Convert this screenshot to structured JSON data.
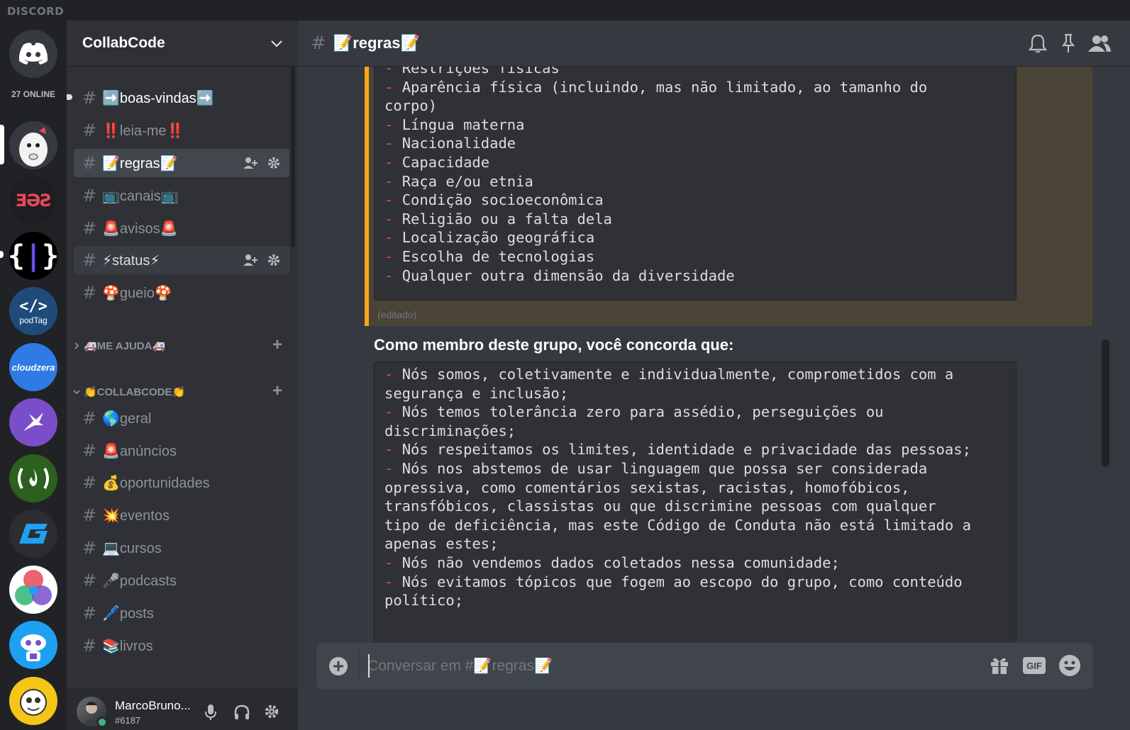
{
  "app": {
    "brand": "DISCORD"
  },
  "rail": {
    "online_count": "27 ONLINE",
    "servers": [
      {
        "id": "home",
        "color": "#36393f",
        "label": ""
      },
      {
        "id": "collabcode",
        "color": "#36393f",
        "label": ""
      },
      {
        "id": "server-3",
        "color": "#1e1e22",
        "label": ""
      },
      {
        "id": "server-4",
        "color": "#000000",
        "label": ""
      },
      {
        "id": "podtag",
        "color": "#1f4b7a",
        "label": "podTag"
      },
      {
        "id": "cloudzera",
        "color": "#2f7ae5",
        "label": "cloudzera"
      },
      {
        "id": "server-7",
        "color": "#7b4ec9",
        "label": ""
      },
      {
        "id": "freecodecamp",
        "color": "#2d5f1e",
        "label": ""
      },
      {
        "id": "server-9",
        "color": "#2b2d31",
        "label": ""
      },
      {
        "id": "server-10",
        "color": "#ffffff",
        "label": ""
      },
      {
        "id": "server-11",
        "color": "#1ea1f2",
        "label": ""
      },
      {
        "id": "server-12",
        "color": "#f5c518",
        "label": ""
      }
    ]
  },
  "guild": {
    "name": "CollabCode"
  },
  "channels": [
    {
      "label": "➡️boas-vindas➡️",
      "state": "unread"
    },
    {
      "label": "‼️leia-me‼️",
      "state": "normal"
    },
    {
      "label": "📝regras📝",
      "state": "active"
    },
    {
      "label": "📺canais📺",
      "state": "normal"
    },
    {
      "label": "🚨avisos🚨",
      "state": "normal"
    },
    {
      "label": "⚡status⚡",
      "state": "hover"
    },
    {
      "label": "🍄gueio🍄",
      "state": "normal"
    }
  ],
  "categories": [
    {
      "label": "🚑ME AJUDA🚑",
      "collapsed": true
    },
    {
      "label": "👏COLLABCODE👏",
      "collapsed": false
    }
  ],
  "collab_channels": [
    {
      "label": "🌎geral"
    },
    {
      "label": "🚨anúncios"
    },
    {
      "label": "💰oportunidades"
    },
    {
      "label": "💥eventos"
    },
    {
      "label": "💻cursos"
    },
    {
      "label": "🎤podcasts"
    },
    {
      "label": "🖊️posts"
    },
    {
      "label": "📚livros"
    }
  ],
  "user": {
    "name": "MarcoBruno...",
    "discriminator": "#6187",
    "status_color": "#43b581"
  },
  "chat": {
    "channel_name": "📝regras📝",
    "list1": [
      "Restrições físicas",
      "Aparência física (incluindo, mas não limitado, ao tamanho do\ncorpo)",
      "Língua materna",
      "Nacionalidade",
      "Capacidade",
      "Raça e/ou etnia",
      "Condição socioeconômica",
      "Religião ou a falta dela",
      "Localização geográfica",
      "Escolha de tecnologias",
      "Qualquer outra dimensão da diversidade"
    ],
    "edited_label": "(editado)",
    "bold_heading": "Como membro deste grupo, você concorda que:",
    "list2": [
      "Nós somos, coletivamente e individualmente, comprometidos com a\nsegurança e inclusão;",
      "Nós temos tolerância zero para assédio, perseguições ou\ndiscriminações;",
      "Nós respeitamos os limites, identidade e privacidade das pessoas;",
      "Nós nos abstemos de usar linguagem que possa ser considerada\nopressiva, como comentários sexistas, racistas, homofóbicos,\ntransfóbicos, classistas ou que discrimine pessoas com qualquer\ntipo de deficiência, mas este Código de Conduta não está limitado a\napenas estes;",
      "Nós não vendemos dados coletados nessa comunidade;",
      "Nós evitamos tópicos que fogem ao escopo do grupo, como conteúdo\npolítico;"
    ],
    "composer_placeholder": "Conversar em #📝regras📝"
  }
}
